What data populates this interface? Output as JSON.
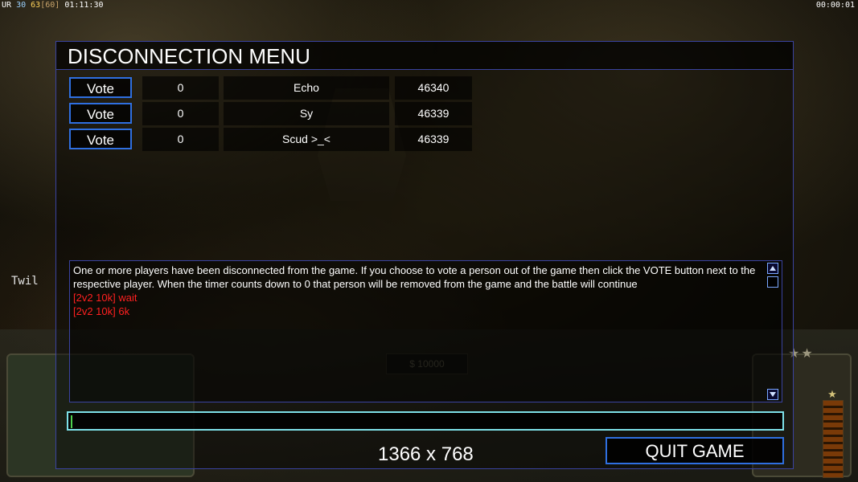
{
  "overlay": {
    "stats_left": {
      "prefix": "UR",
      "a": "30",
      "b": "63",
      "c": "[60]",
      "clock": "01:11:30"
    },
    "stats_right": "00:00:01",
    "player_tag": "Twil"
  },
  "hud": {
    "money": "$ 10000",
    "stars": "★★"
  },
  "dialog": {
    "title": "DISCONNECTION MENU",
    "players": [
      {
        "vote_label": "Vote",
        "count": "0",
        "name": "Echo",
        "ping": "46340"
      },
      {
        "vote_label": "Vote",
        "count": "0",
        "name": "Sy",
        "ping": "46339"
      },
      {
        "vote_label": "Vote",
        "count": "0",
        "name": "Scud >_<",
        "ping": "46339"
      }
    ],
    "chat": {
      "system_message": "One or more players have been disconnected from the game. If you choose to vote a person out of the game then click the VOTE button next to the respective player. When the timer counts down to 0 that person will be removed from the game and the battle will continue",
      "messages": [
        "[2v2 10k] wait",
        "[2v2 10k] 6k"
      ]
    },
    "chat_input_value": "",
    "resolution": "1366 x 768",
    "quit_label": "QUIT GAME"
  }
}
